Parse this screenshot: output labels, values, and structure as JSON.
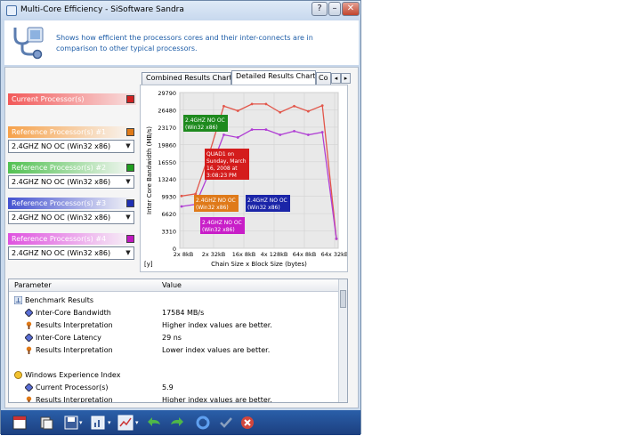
{
  "window": {
    "title": "Multi-Core Efficiency - SiSoftware Sandra",
    "description": "Shows how efficient the processors cores and their inter-connects are in comparison to other typical processors.",
    "buttons": {
      "help": "?",
      "minimize": "–",
      "close": "✕"
    }
  },
  "processors": {
    "current": {
      "label": "Current Processor(s)",
      "color": "#d22020"
    },
    "refs": [
      {
        "label": "Reference Processor(s) #1",
        "color": "#e07a18",
        "bg": "#f6a14a",
        "selected": "2.4GHZ NO OC (Win32 x86)"
      },
      {
        "label": "Reference Processor(s) #2",
        "color": "#1f9e1f",
        "bg": "#52c152",
        "selected": "2.4GHZ NO OC (Win32 x86)"
      },
      {
        "label": "Reference Processor(s) #3",
        "color": "#1f2fb3",
        "bg": "#4452d0",
        "selected": "2.4GHZ NO OC (Win32 x86)"
      },
      {
        "label": "Reference Processor(s) #4",
        "color": "#c018c0",
        "bg": "#df52df",
        "selected": "2.4GHZ NO OC (Win32 x86)"
      }
    ]
  },
  "tabs": [
    "Combined Results Chart",
    "Detailed Results Chart",
    "Co"
  ],
  "chart_data": {
    "type": "line",
    "ylabel": "Inter Core Bandwidth (MB/s)",
    "xlabel": "Chain Size x Block Size (bytes)",
    "corner_label": "[y]",
    "yticks": [
      "29790",
      "26480",
      "23170",
      "19860",
      "16550",
      "13240",
      "9930",
      "6620",
      "3310",
      "0"
    ],
    "ylim": [
      0,
      29790
    ],
    "xticks": [
      "2x 8kB",
      "2x 32kB",
      "16x 8kB",
      "4x 128kB",
      "64x 8kB",
      "64x 32kB"
    ],
    "series": [
      {
        "name": "Current",
        "color": "#e2564a",
        "values": [
          10000,
          10400,
          18400,
          27200,
          26300,
          27600,
          27600,
          26000,
          27200,
          26200,
          27300,
          1800
        ]
      },
      {
        "name": "Reference",
        "color": "#b03fd4",
        "values": [
          8000,
          8400,
          14700,
          21700,
          21200,
          22700,
          22700,
          21700,
          22400,
          21700,
          22200,
          1800
        ]
      }
    ],
    "annotations": [
      {
        "text": [
          "2.4GHZ NO OC",
          "(Win32 x86)"
        ],
        "color": "#1e8a1e"
      },
      {
        "text": [
          "QUAD1 on",
          "Sunday, March",
          "16, 2008 at",
          "3:08:23 PM"
        ],
        "color": "#d41c1c"
      },
      {
        "text": [
          "2.4GHZ NO OC",
          "(Win32 x86)"
        ],
        "color": "#df7a1a"
      },
      {
        "text": [
          "2.4GHZ NO OC",
          "(Win32 x86)"
        ],
        "color": "#1b25a8"
      },
      {
        "text": [
          "2.4GHZ NO OC",
          "(Win32 x86)"
        ],
        "color": "#c81ec8"
      }
    ]
  },
  "table": {
    "headers": [
      "Parameter",
      "Value"
    ],
    "rows": [
      {
        "param": "Benchmark Results",
        "value": "",
        "level": 0,
        "icon": "benchmark-icon"
      },
      {
        "param": "Inter-Core Bandwidth",
        "value": "17584 MB/s",
        "level": 1,
        "icon": "diamond-icon"
      },
      {
        "param": "Results Interpretation",
        "value": "Higher index values are better.",
        "level": 1,
        "icon": "pin-icon"
      },
      {
        "param": "Inter-Core Latency",
        "value": "29 ns",
        "level": 1,
        "icon": "diamond-icon"
      },
      {
        "param": "Results Interpretation",
        "value": "Lower index values are better.",
        "level": 1,
        "icon": "pin-icon"
      },
      {
        "param": "",
        "value": "",
        "level": 0,
        "icon": ""
      },
      {
        "param": "Windows Experience Index",
        "value": "",
        "level": 0,
        "icon": "wei-icon"
      },
      {
        "param": "Current Processor(s)",
        "value": "5.9",
        "level": 1,
        "icon": "diamond-icon"
      },
      {
        "param": "Results Interpretation",
        "value": "Higher index values are better.",
        "level": 1,
        "icon": "pin-icon"
      }
    ]
  }
}
